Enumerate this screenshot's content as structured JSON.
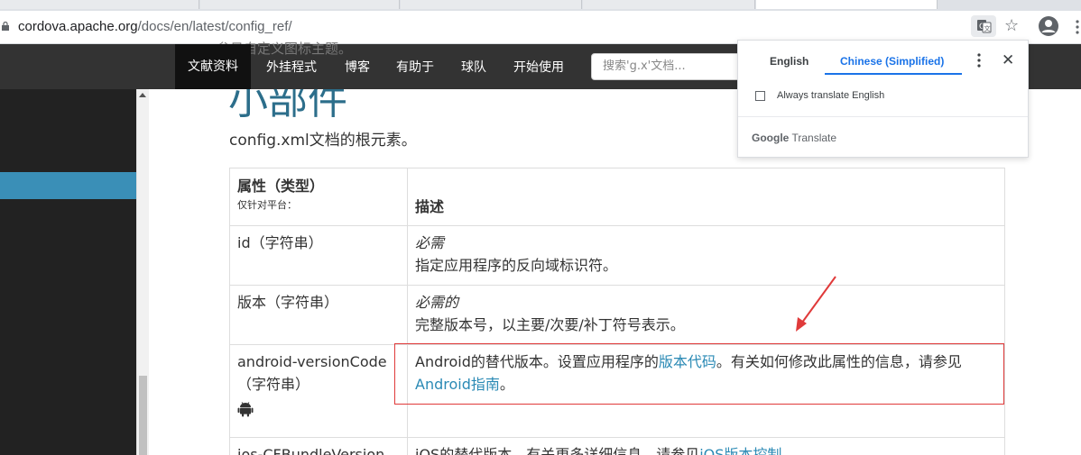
{
  "browser": {
    "url_host": "cordova.apache.org",
    "url_path": "/docs/en/latest/config_ref/"
  },
  "site_nav": {
    "overlap_text": "参见自定义图标主题。",
    "items": [
      {
        "label": "文献资料",
        "active": true
      },
      {
        "label": "外挂程式"
      },
      {
        "label": "博客"
      },
      {
        "label": "有助于"
      },
      {
        "label": "球队"
      },
      {
        "label": "开始使用"
      }
    ],
    "search_placeholder": "搜索'g.x'文档..."
  },
  "content": {
    "heading": "小部件",
    "intro": "config.xml文档的根元素。",
    "table": {
      "header_attr": "属性（类型）",
      "header_attr_sub": "仅针对平台：",
      "header_desc": "描述",
      "rows": [
        {
          "attr": "id（字符串）",
          "req": "必需",
          "desc": "指定应用程序的反向域标识符。"
        },
        {
          "attr": "版本（字符串）",
          "req": "必需的",
          "desc": "完整版本号，以主要/次要/补丁符号表示。"
        },
        {
          "attr": "android-versionCode",
          "attr_type": "（字符串）",
          "desc_pre": "Android的替代版本。设置应用程序的",
          "desc_link1": "版本代码",
          "desc_mid": "。有关如何修改此属性的信息，请参见",
          "desc_link2": "Android指南",
          "desc_post": "。"
        },
        {
          "attr": "ios-CFBundleVersion",
          "desc_pre": "iOS的替代版本。有关更多详细信息，请参见",
          "desc_link1": "iOS版本控制",
          "desc_post": "。"
        }
      ]
    }
  },
  "translate_popup": {
    "tab_source": "English",
    "tab_target": "Chinese (Simplified)",
    "checkbox_label": "Always translate English",
    "brand_google": "Google",
    "brand_translate": "Translate"
  },
  "colors": {
    "nav_bg": "#333333",
    "heading": "#2c6e8b",
    "link": "#2b8ab5",
    "sidebar_selected": "#3a8fb7",
    "annotation": "#e03a3a",
    "translate_accent": "#1a73e8"
  }
}
